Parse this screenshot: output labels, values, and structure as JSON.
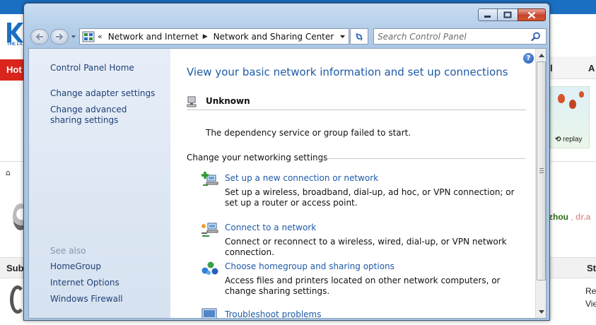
{
  "background_page": {
    "hot_label": "Hot",
    "right_tab_letters": [
      "l",
      "A"
    ],
    "logo_tagline": "THE LA",
    "ad_text": "replay",
    "user_names": [
      "zhou",
      "dr.a"
    ],
    "name_separator": ",",
    "sub_header_left": "Sub",
    "sub_header_right": "St",
    "right_text_lines": [
      "Re",
      "Vie"
    ]
  },
  "window": {
    "address_bar": {
      "overflow_chevron": "«",
      "breadcrumbs": [
        "Network and Internet",
        "Network and Sharing Center"
      ]
    },
    "search": {
      "placeholder": "Search Control Panel"
    },
    "sidebar": {
      "links": [
        "Control Panel Home",
        "Change adapter settings",
        "Change advanced sharing settings"
      ],
      "see_also_label": "See also",
      "see_also_links": [
        "HomeGroup",
        "Internet Options",
        "Windows Firewall"
      ]
    },
    "main": {
      "title": "View your basic network information and set up connections",
      "help_label": "?",
      "network_name": "Unknown",
      "network_status": "The dependency service or group failed to start.",
      "section_title": "Change your networking settings",
      "tasks": [
        {
          "icon": "new-connection-icon",
          "link": "Set up a new connection or network",
          "description": "Set up a wireless, broadband, dial-up, ad hoc, or VPN connection; or set up a router or access point."
        },
        {
          "icon": "connect-network-icon",
          "link": "Connect to a network",
          "description": "Connect or reconnect to a wireless, wired, dial-up, or VPN network connection."
        },
        {
          "icon": "homegroup-icon",
          "link": "Choose homegroup and sharing options",
          "description": "Access files and printers located on other network computers, or change sharing settings."
        },
        {
          "icon": "troubleshoot-icon",
          "link": "Troubleshoot problems",
          "description": ""
        }
      ]
    }
  }
}
